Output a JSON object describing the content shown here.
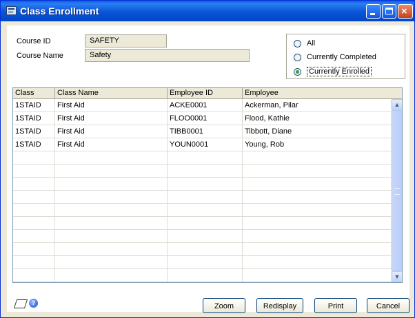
{
  "window": {
    "title": "Class Enrollment"
  },
  "course": {
    "id_label": "Course ID",
    "id_value": "SAFETY",
    "name_label": "Course Name",
    "name_value": "Safety"
  },
  "filter": {
    "options": [
      "All",
      "Currently Completed",
      "Currently Enrolled"
    ],
    "selected": "Currently Enrolled"
  },
  "grid": {
    "columns": [
      "Class",
      "Class Name",
      "Employee ID",
      "Employee"
    ],
    "rows": [
      [
        "1STAID",
        "First Aid",
        "ACKE0001",
        "Ackerman, Pilar"
      ],
      [
        "1STAID",
        "First Aid",
        "FLOO0001",
        "Flood, Kathie"
      ],
      [
        "1STAID",
        "First Aid",
        "TIBB0001",
        "Tibbott, Diane"
      ],
      [
        "1STAID",
        "First Aid",
        "YOUN0001",
        "Young, Rob"
      ]
    ]
  },
  "buttons": {
    "zoom": "Zoom",
    "redisplay": "Redisplay",
    "print": "Print",
    "cancel": "Cancel"
  },
  "colors": {
    "titlebar": "#0a55d6",
    "window_bg": "#ece9d8",
    "selected_radio": "#2fa02f"
  }
}
